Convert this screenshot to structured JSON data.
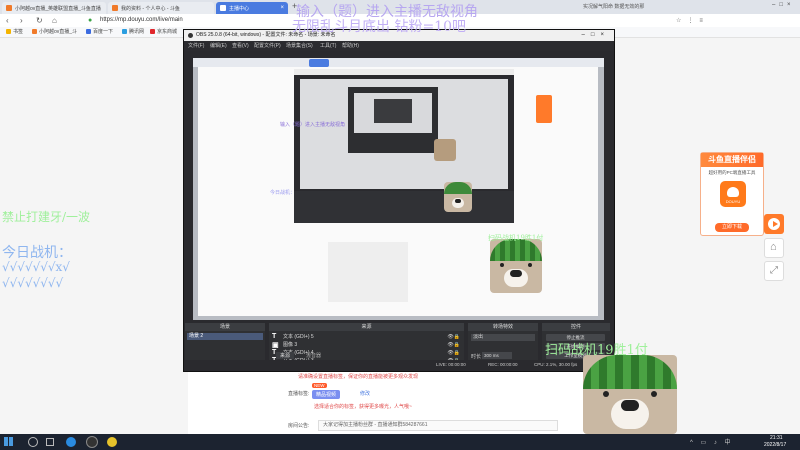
{
  "browser": {
    "tabs": [
      {
        "label": "小阿越ov直播_英雄联盟直播_斗鱼直播",
        "active": false
      },
      {
        "label": "我的资料 - 个人中心 - 斗鱼",
        "active": false
      },
      {
        "label": "主播中心",
        "active": true
      }
    ],
    "url": "https://mp.douyu.com/live/main",
    "bookmarks": [
      "书签",
      "小阿越ov直播_斗",
      "百度一下",
      "腾讯网",
      "京东商城"
    ],
    "right_info": "实况解气阳命 数据无效的那"
  },
  "overlay": {
    "line1": "输入（题）进入主播无敌视角",
    "line2": "无限乱斗月底出   钻粉=10吧",
    "left_warning": "禁止打建牙/一波",
    "left_today": "今日战机：",
    "left_checks": "√√√√√√√x√",
    "left_checks2": "√√√√√√√√",
    "bottom_scan": "扫码战机19胜1付"
  },
  "obs": {
    "title": "OBS 25.0.8 (64-bit, windows) - 配置文件: 未命名 - 场景: 未命名",
    "menu": [
      "文件(F)",
      "编辑(E)",
      "查看(V)",
      "配置文件(P)",
      "场景集合(S)",
      "工具(T)",
      "帮助(H)"
    ],
    "docks": {
      "scenes_title": "场景",
      "scenes": [
        "场景 2"
      ],
      "sources_title": "来源",
      "sources": [
        "文本 (GDI+) 5",
        "图像 3",
        "文本 (GDI+) 4",
        "文本 (GDI+) 3",
        "文本 (GDI+) 2"
      ],
      "mixer_title": "转场特效",
      "transition": "淡出",
      "duration_label": "时长",
      "duration": "300 ms",
      "controls_title": "控件",
      "controls": [
        "停止推流",
        "开始录制",
        "工作室模式",
        "设置",
        "退出"
      ]
    },
    "tabs": [
      "来源",
      "混音器"
    ],
    "status": {
      "live": "LIVE: 00:00:00",
      "rec": "REC: 00:00:00",
      "cpu": "CPU: 2.1%, 30.00 fps"
    }
  },
  "page": {
    "label_title": "直播标签:",
    "tag": "精品视频",
    "modify": "修改",
    "tip1": "请准确设置直播标签，保证你的直播能被更多观众发现",
    "tip2": "选择适合你的标签，获得更多曝光，人气哦~",
    "notice_label": "房间公告:",
    "notice": "大家记得加主播粉丝群 - 直播通知群584287661",
    "new_badge": "NEW"
  },
  "ad": {
    "title": "斗鱼直播伴侣",
    "subtitle": "超好用的PC端直播工具",
    "logo_text": "DOUYU",
    "button": "立即下载"
  },
  "taskbar": {
    "time": "21:31",
    "date": "2022/8/17"
  },
  "colors": {
    "accent": "#4a7be0",
    "ad_orange": "#ff6a2a",
    "overlay_purple": "#b7a7f0",
    "overlay_green": "#9ff09b"
  }
}
